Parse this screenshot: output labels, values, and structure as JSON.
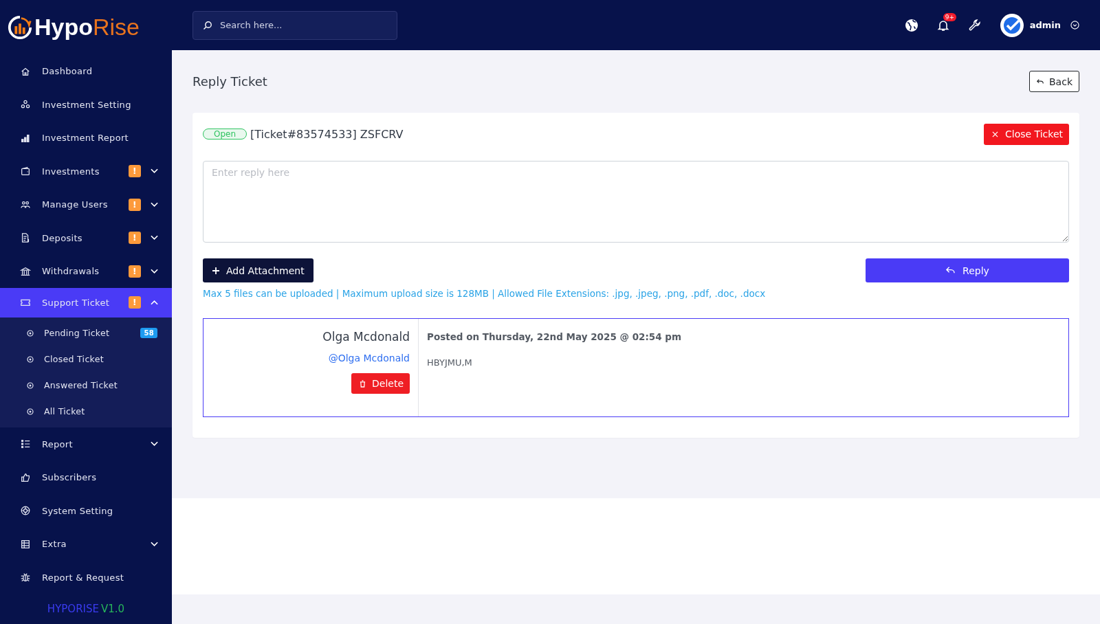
{
  "logo": {
    "part_1": "Hypo",
    "part_2": "Rise"
  },
  "sidebar": {
    "items": [
      {
        "label": "Dashboard",
        "kind": "link",
        "selected": false
      },
      {
        "label": "Investment Setting",
        "kind": "link",
        "selected": false
      },
      {
        "label": "Investment Report",
        "kind": "link",
        "selected": false
      },
      {
        "label": "Investments",
        "kind": "group",
        "badge": "!",
        "expanded": false,
        "selected": false
      },
      {
        "label": "Manage Users",
        "kind": "group",
        "badge": "!",
        "expanded": false,
        "selected": false
      },
      {
        "label": "Deposits",
        "kind": "group",
        "badge": "!",
        "expanded": false,
        "selected": false
      },
      {
        "label": "Withdrawals",
        "kind": "group",
        "badge": "!",
        "expanded": false,
        "selected": false
      },
      {
        "label": "Support Ticket",
        "kind": "group",
        "badge": "!",
        "expanded": true,
        "selected": true,
        "children": [
          {
            "label": "Pending Ticket",
            "badge": "58",
            "selected": false
          },
          {
            "label": "Closed Ticket",
            "selected": false
          },
          {
            "label": "Answered Ticket",
            "selected": false
          },
          {
            "label": "All Ticket",
            "selected": false
          }
        ]
      },
      {
        "label": "Report",
        "kind": "group",
        "expanded": false,
        "selected": false
      },
      {
        "label": "Subscribers",
        "kind": "link",
        "selected": false
      },
      {
        "label": "System Setting",
        "kind": "link",
        "selected": false
      },
      {
        "label": "Extra",
        "kind": "group",
        "expanded": false,
        "selected": false
      },
      {
        "label": "Report & Request",
        "kind": "link",
        "selected": false
      }
    ],
    "version": {
      "name": "HYPORISE",
      "number": "V1.0"
    }
  },
  "header": {
    "search": {
      "placeholder": "Search here..."
    },
    "notification_count": "9+",
    "user": "admin"
  },
  "page": {
    "title": "Reply Ticket",
    "back_button": "Back"
  },
  "ticket": {
    "status": "Open",
    "title": "[Ticket#83574533] ZSFCRV",
    "close_button": "Close Ticket",
    "reply": {
      "placeholder": "Enter reply here"
    },
    "attachment_button": "Add Attachment",
    "reply_button": "Reply",
    "upload_info": "Max 5 files can be uploaded | Maximum upload size is 128MB | Allowed File Extensions: .jpg, .jpeg, .png, .pdf, .doc, .docx",
    "messages": [
      {
        "author": "Olga Mcdonald",
        "handle": "@Olga Mcdonald",
        "delete_button": "Delete",
        "posted": "Posted on Thursday, 22nd May 2025 @ 02:54 pm",
        "body": "HBYJMU,M"
      }
    ]
  }
}
